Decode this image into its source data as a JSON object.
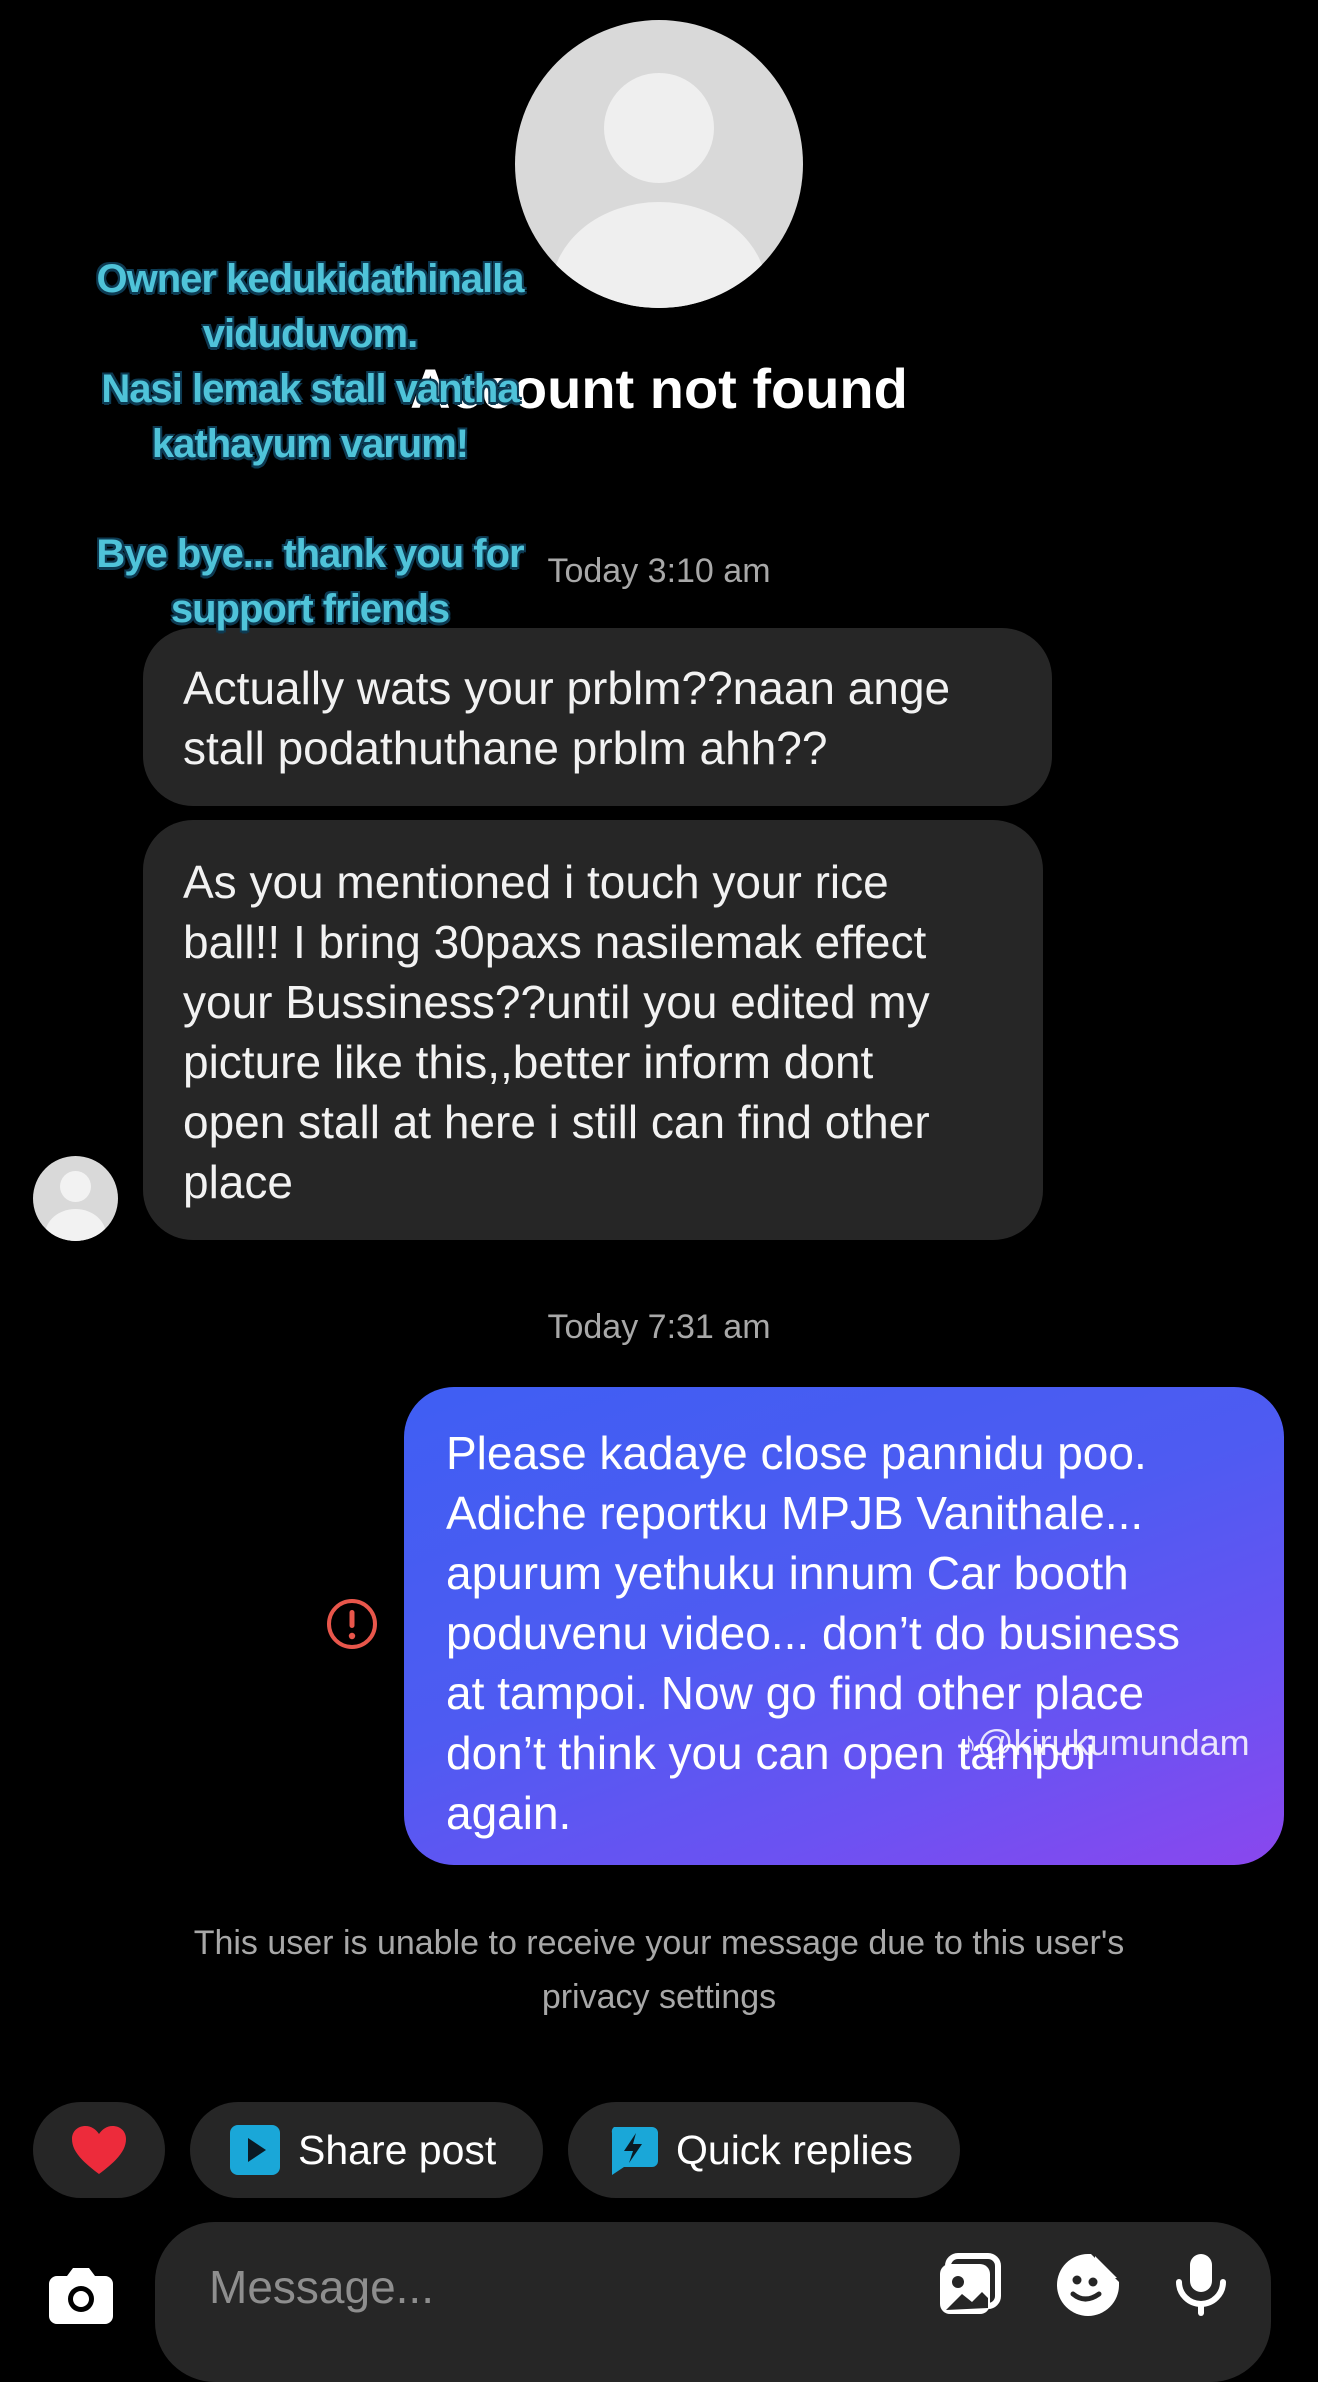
{
  "header": {
    "title": "Account not found"
  },
  "caption": {
    "text": "Owner kedukidathinalla\nviduduvom.\nNasi lemak stall vantha\nkathayum varum!\n\nBye bye... thank you for\nsupport friends"
  },
  "conversation": {
    "timestamp_1": "Today 3:10 am",
    "received": [
      "Actually wats your prblm??naan ange\nstall podathuthane prblm ahh??",
      "As you mentioned i touch your rice\nball!! I bring 30paxs nasilemak effect\nyour Bussiness??until you edited my\npicture like this,,better inform dont\nopen stall at here i still can find other\nplace"
    ],
    "timestamp_2": "Today 7:31 am",
    "sent": "Please kadaye close pannidu poo.\nAdiche reportku MPJB Vanithale...\napurum yethuku innum Car booth\npoduvenu video... don’t do business\nat tampoi.  Now go find other place\ndon’t think you can open tampoi\nagain.",
    "watermark": "@kirukumundam",
    "delivery_notice": "This user is unable to receive your message due to this user's\nprivacy settings"
  },
  "quick_actions": {
    "heart_icon": "heart-icon",
    "share_post_label": "Share post",
    "quick_replies_label": "Quick replies"
  },
  "composer": {
    "placeholder": "Message...",
    "icons": [
      "camera-icon",
      "gallery-icon",
      "sticker-icon",
      "microphone-icon"
    ]
  },
  "colors": {
    "background": "#000000",
    "received_bubble": "#262626",
    "sent_gradient_start": "#3f5ef3",
    "sent_gradient_end": "#8a47ee",
    "error": "#e8564b",
    "caption": "#4fc3d9",
    "share_icon": "#1aa7d8"
  }
}
